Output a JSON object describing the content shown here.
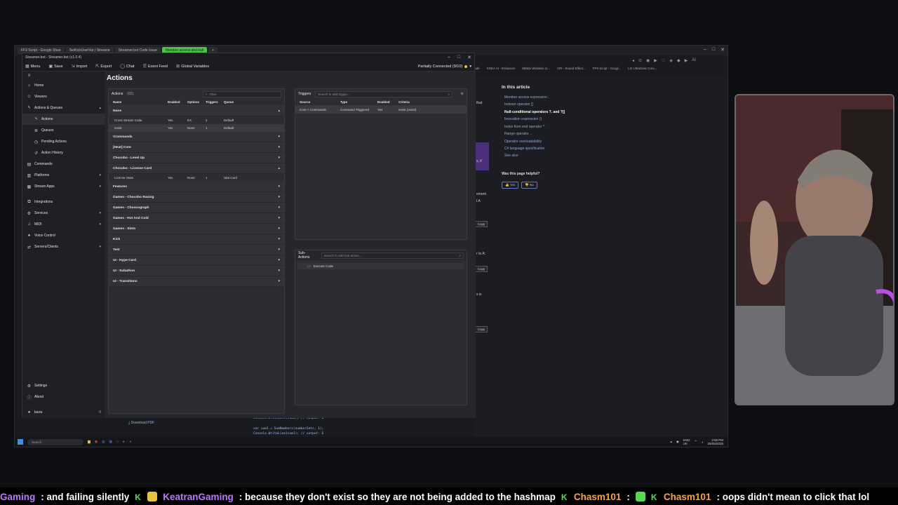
{
  "browser": {
    "tabs": [
      "FF9 Script - Google Shee",
      "SetKickUserVar | Streame",
      "Streamer.bot Code Issue",
      "Member access and null"
    ],
    "bookmarks": [
      "Code",
      "KREA AI - Enhancer",
      "8Bitdo Wireless U...",
      "VIR - Sound Effect...",
      "FF9 Script - Googl...",
      "LG UltraGear Curv..."
    ],
    "ai_label": "AI"
  },
  "app": {
    "title": "Streamer.bot - Streamer.bot (v1.0.4)",
    "connection": "Partially Connected (9/10)",
    "toolbar": [
      "Menu",
      "Save",
      "Import",
      "Export",
      "Chat",
      "Event Feed",
      "Global Variables"
    ]
  },
  "sidebar": {
    "items": [
      {
        "label": "Home",
        "icon": "home-icon"
      },
      {
        "label": "Viewers",
        "icon": "viewers-icon"
      },
      {
        "label": "Actions & Queues",
        "icon": "bolt-icon",
        "expanded": true
      },
      {
        "label": "Actions",
        "icon": "bolt-icon",
        "sub": true,
        "selected": true
      },
      {
        "label": "Queues",
        "icon": "queue-icon",
        "sub": true
      },
      {
        "label": "Pending Actions",
        "icon": "pending-icon",
        "sub": true
      },
      {
        "label": "Action History",
        "icon": "history-icon",
        "sub": true
      },
      {
        "label": "Commands",
        "icon": "commands-icon"
      },
      {
        "label": "Platforms",
        "icon": "platforms-icon"
      },
      {
        "label": "Stream Apps",
        "icon": "apps-icon"
      },
      {
        "label": "Integrations",
        "icon": "integrations-icon"
      },
      {
        "label": "Services",
        "icon": "services-icon"
      },
      {
        "label": "MIDI",
        "icon": "midi-icon"
      },
      {
        "label": "Voice Control",
        "icon": "mic-icon"
      },
      {
        "label": "Servers/Clients",
        "icon": "servers-icon"
      }
    ],
    "bottom": [
      {
        "label": "Settings",
        "icon": "gear-icon"
      },
      {
        "label": "About",
        "icon": "info-icon"
      }
    ],
    "user": "laura",
    "user_count": "0"
  },
  "main": {
    "title": "Actions",
    "actions_panel": {
      "label": "Actions",
      "count": "(82)",
      "filter_placeholder": "Filter",
      "columns": [
        "Name",
        "Enabled",
        "Options",
        "Triggers",
        "Queue"
      ],
      "groups": [
        {
          "name": "None",
          "expanded": true,
          "rows": [
            [
              "Cross Stream Code",
              "Yes",
              "EX",
              "2",
              "Default"
            ],
            [
              "!exist",
              "Yes",
              "None",
              "1",
              "Default"
            ]
          ]
        },
        {
          "name": "!Commands",
          "expanded": false,
          "rows": []
        },
        {
          "name": "[Heat] Core",
          "expanded": false,
          "rows": []
        },
        {
          "name": "Chocobo - Level Up",
          "expanded": false,
          "rows": []
        },
        {
          "name": "Chocobo - License Card",
          "expanded": true,
          "rows": [
            [
              "License Stats",
              "Yes",
              "None",
              "1",
              "Stat Card"
            ]
          ]
        },
        {
          "name": "Features",
          "expanded": false,
          "rows": []
        },
        {
          "name": "Games - Chocobo Racing",
          "expanded": false,
          "rows": []
        },
        {
          "name": "Games - Choocograph",
          "expanded": false,
          "rows": []
        },
        {
          "name": "Games - Hot And Cold",
          "expanded": false,
          "rows": []
        },
        {
          "name": "Games - Slots",
          "expanded": false,
          "rows": []
        },
        {
          "name": "Kick",
          "expanded": false,
          "rows": []
        },
        {
          "name": "Test",
          "expanded": false,
          "rows": []
        },
        {
          "name": "UI - Hype Card",
          "expanded": false,
          "rows": []
        },
        {
          "name": "UI - Subathon",
          "expanded": false,
          "rows": []
        },
        {
          "name": "UI - Transitions",
          "expanded": false,
          "rows": []
        }
      ]
    },
    "triggers_panel": {
      "label": "Triggers",
      "search_placeholder": "Search to add trigger...",
      "columns": [
        "Source",
        "Type",
        "Enabled",
        "Criteria"
      ],
      "rows": [
        [
          "Core > Commands",
          "Command Triggered",
          "Yes",
          "!exist (!exist)"
        ]
      ]
    },
    "subactions_panel": {
      "label": "Sub-Actions",
      "search_placeholder": "Search to add sub-action...",
      "items": [
        "Execute Code"
      ]
    }
  },
  "doc": {
    "in_this_article": "In this article",
    "links": [
      "Member access expression .",
      "Indexer operator []",
      "Null-conditional operators ?. and ?[]",
      "Invocation expression ()",
      "Index from end operator ^",
      "Range operator ..",
      "Operator overloadability",
      "C# language specification",
      "See also"
    ],
    "active_link": 2,
    "helpful": "Was this page helpful?",
    "yes": "Yes",
    "no": "No",
    "copy": "Copy",
    "fragments": [
      "that",
      "s, if",
      "ement",
      "t A",
      "r to A:",
      "s is"
    ],
    "download_pdf": "Download PDF",
    "code": [
      "Console.WriteLine(sum1); // output: 6",
      "var sum1 = SumNumbers(numberSets, 1);",
      "Console.WriteLine(sum1); // output: 6"
    ]
  },
  "taskbar": {
    "search": "Search",
    "lang": "ENG",
    "region": "UK",
    "time": "3:58 PM",
    "date": "25/05/2025"
  },
  "chat": [
    {
      "user": "Gaming",
      "color": "#b979f5",
      "message": ": and failing silently"
    },
    {
      "user": "KeatranGaming",
      "color": "#b979f5",
      "message": ": because they don't exist so they are not being added to the hashmap"
    },
    {
      "user": "Chasm101",
      "color": "#f5a43b",
      "message": ":"
    },
    {
      "user": "Chasm101",
      "color": "#f5a43b",
      "message": ": oops didn't mean to click that lol"
    }
  ],
  "colors": {
    "accent_green": "#54d84d",
    "kick_green": "#54d84d",
    "purple": "#b979f5",
    "orange": "#f5a43b",
    "status_yellow": "#f2c230"
  }
}
